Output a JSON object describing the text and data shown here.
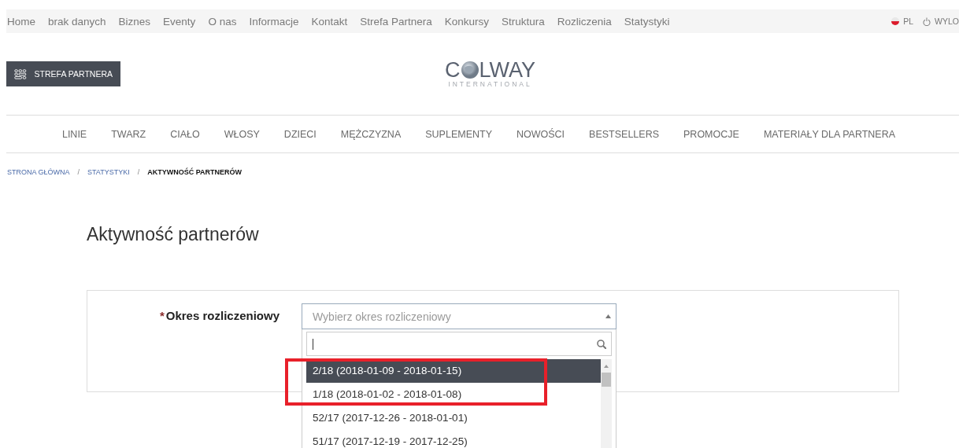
{
  "top_nav": {
    "links": [
      "Home",
      "brak danych",
      "Biznes",
      "Eventy",
      "O nas",
      "Informacje",
      "Kontakt",
      "Strefa Partnera",
      "Konkursy",
      "Struktura",
      "Rozliczenia",
      "Statystyki"
    ],
    "language": "PL",
    "logout": "WYLO"
  },
  "header": {
    "partner_button": "STREFA PARTNERA",
    "logo": {
      "before_globe": "C",
      "after_globe": "LWAY",
      "subtitle": "INTERNATIONAL"
    }
  },
  "category_nav": [
    "LINIE",
    "TWARZ",
    "CIAŁO",
    "WŁOSY",
    "DZIECI",
    "MĘŻCZYZNA",
    "SUPLEMENTY",
    "NOWOŚCI",
    "BESTSELLERS",
    "PROMOCJE",
    "MATERIAŁY DLA PARTNERA"
  ],
  "breadcrumb": [
    {
      "label": "STRONA GŁÓWNA",
      "current": false
    },
    {
      "label": "STATYSTYKI",
      "current": false
    },
    {
      "label": "AKTYWNOŚĆ PARTNERÓW",
      "current": true
    }
  ],
  "breadcrumb_separator": "/",
  "page_title": "Aktywność partnerów",
  "form": {
    "required_mark": "*",
    "label": "Okres rozliczeniowy",
    "select": {
      "placeholder": "Wybierz okres rozliczeniowy",
      "expanded": true
    },
    "options": [
      {
        "label": "2/18 (2018-01-09 - 2018-01-15)",
        "selected": true
      },
      {
        "label": "1/18 (2018-01-02 - 2018-01-08)",
        "selected": false
      },
      {
        "label": "52/17 (2017-12-26 - 2018-01-01)",
        "selected": false
      },
      {
        "label": "51/17 (2017-12-19 - 2017-12-25)",
        "selected": false
      }
    ]
  }
}
